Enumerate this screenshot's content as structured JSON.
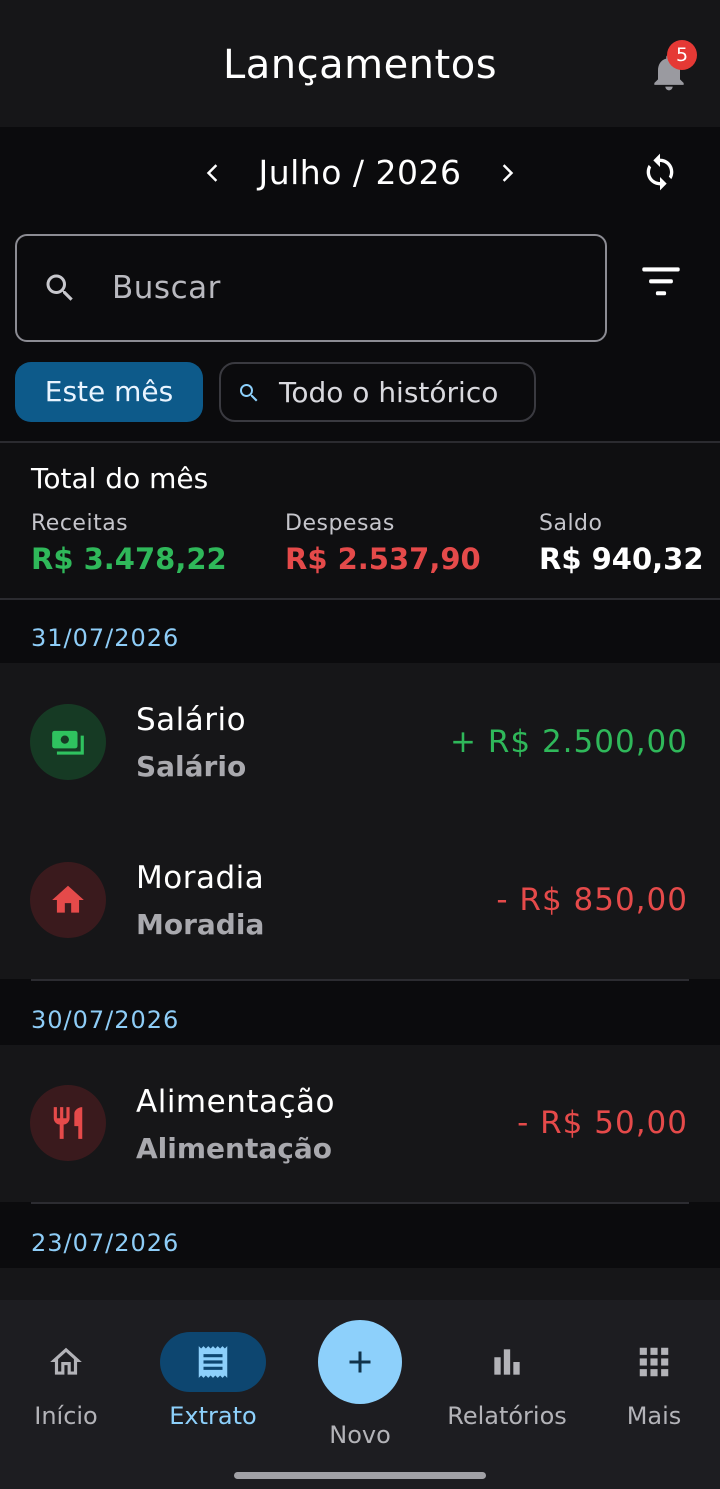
{
  "app": {
    "title": "Lançamentos",
    "notification_count": "5"
  },
  "period": {
    "label": "Julho / 2026"
  },
  "search": {
    "placeholder": "Buscar"
  },
  "chips": {
    "current_month": "Este mês",
    "all_history": "Todo o histórico"
  },
  "summary": {
    "title": "Total do mês",
    "income_label": "Receitas",
    "income_value": "R$ 3.478,22",
    "expense_label": "Despesas",
    "expense_value": "R$ 2.537,90",
    "balance_label": "Saldo",
    "balance_value": "R$ 940,32"
  },
  "groups": [
    {
      "date": "31/07/2026",
      "transactions": [
        {
          "title": "Salário",
          "category": "Salário",
          "amount": "+ R$ 2.500,00",
          "type": "income",
          "icon": "money-icon"
        },
        {
          "title": "Moradia",
          "category": "Moradia",
          "amount": "- R$ 850,00",
          "type": "expense",
          "icon": "home-icon"
        }
      ]
    },
    {
      "date": "30/07/2026",
      "transactions": [
        {
          "title": "Alimentação",
          "category": "Alimentação",
          "amount": "- R$ 50,00",
          "type": "expense",
          "icon": "fork-knife-icon"
        }
      ]
    },
    {
      "date": "23/07/2026",
      "transactions": []
    }
  ],
  "nav": {
    "home": "Início",
    "statement": "Extrato",
    "new": "Novo",
    "reports": "Relatórios",
    "more": "Mais"
  },
  "colors": {
    "income": "#2fb85a",
    "expense": "#e54a4a",
    "accent": "#8dd0fb",
    "chip_active": "#0d5a8a",
    "date_header": "#8ecdf7"
  }
}
